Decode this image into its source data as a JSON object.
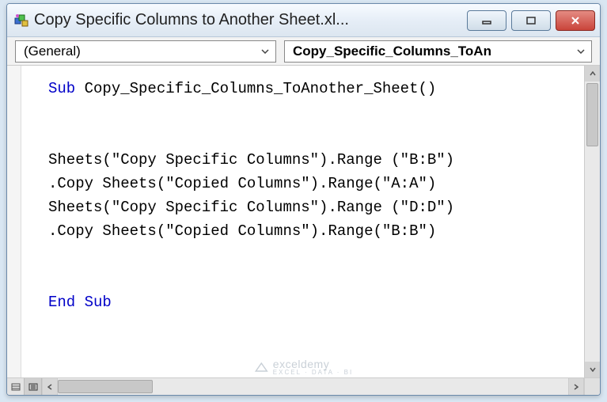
{
  "window": {
    "title": "Copy Specific Columns to Another Sheet.xl..."
  },
  "dropdowns": {
    "left": "(General)",
    "right": "Copy_Specific_Columns_ToAn"
  },
  "code": {
    "sub_kw": "Sub",
    "sub_name": " Copy_Specific_Columns_ToAnother_Sheet()",
    "line1": "Sheets(\"Copy Specific Columns\").Range (\"B:B\")",
    "line2": ".Copy Sheets(\"Copied Columns\").Range(\"A:A\")",
    "line3": "Sheets(\"Copy Specific Columns\").Range (\"D:D\")",
    "line4": ".Copy Sheets(\"Copied Columns\").Range(\"B:B\")",
    "end_kw": "End Sub"
  },
  "watermark": {
    "main": "exceldemy",
    "sub": "EXCEL · DATA · BI"
  }
}
